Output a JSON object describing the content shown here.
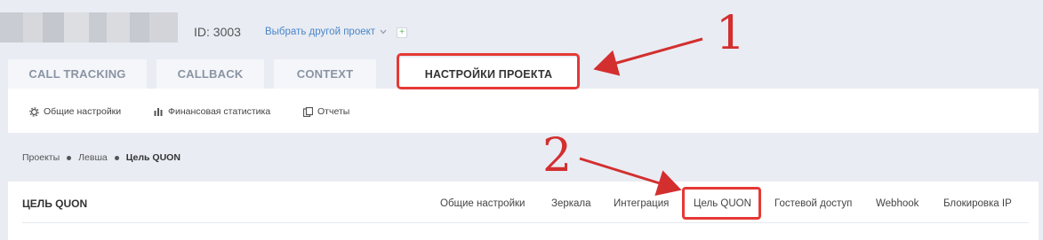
{
  "header": {
    "project_id": "ID: 3003",
    "choose_project": "Выбрать другой проект",
    "chevron_icon": "chevron-down-icon",
    "add_icon": "plus-icon",
    "add_symbol": "+"
  },
  "tabs": [
    {
      "label": "CALL TRACKING"
    },
    {
      "label": "CALLBACK"
    },
    {
      "label": "CONTEXT"
    },
    {
      "label": "НАСТРОЙКИ ПРОЕКТА"
    }
  ],
  "subnav": [
    {
      "label": "Общие настройки",
      "icon": "gear-icon"
    },
    {
      "label": "Финансовая статистика",
      "icon": "bar-chart-icon"
    },
    {
      "label": "Отчеты",
      "icon": "report-icon"
    }
  ],
  "breadcrumb": {
    "items": [
      "Проекты",
      "Левша"
    ],
    "current": "Цель QUON"
  },
  "section": {
    "title": "ЦЕЛЬ QUON"
  },
  "project_tabs": [
    {
      "label": "Общие настройки"
    },
    {
      "label": "Зеркала"
    },
    {
      "label": "Интеграция"
    },
    {
      "label": "Цель QUON"
    },
    {
      "label": "Гостевой доступ"
    },
    {
      "label": "Webhook"
    },
    {
      "label": "Блокировка IP"
    }
  ],
  "annotations": {
    "first": "1",
    "second": "2",
    "color": "#d32f2f"
  }
}
